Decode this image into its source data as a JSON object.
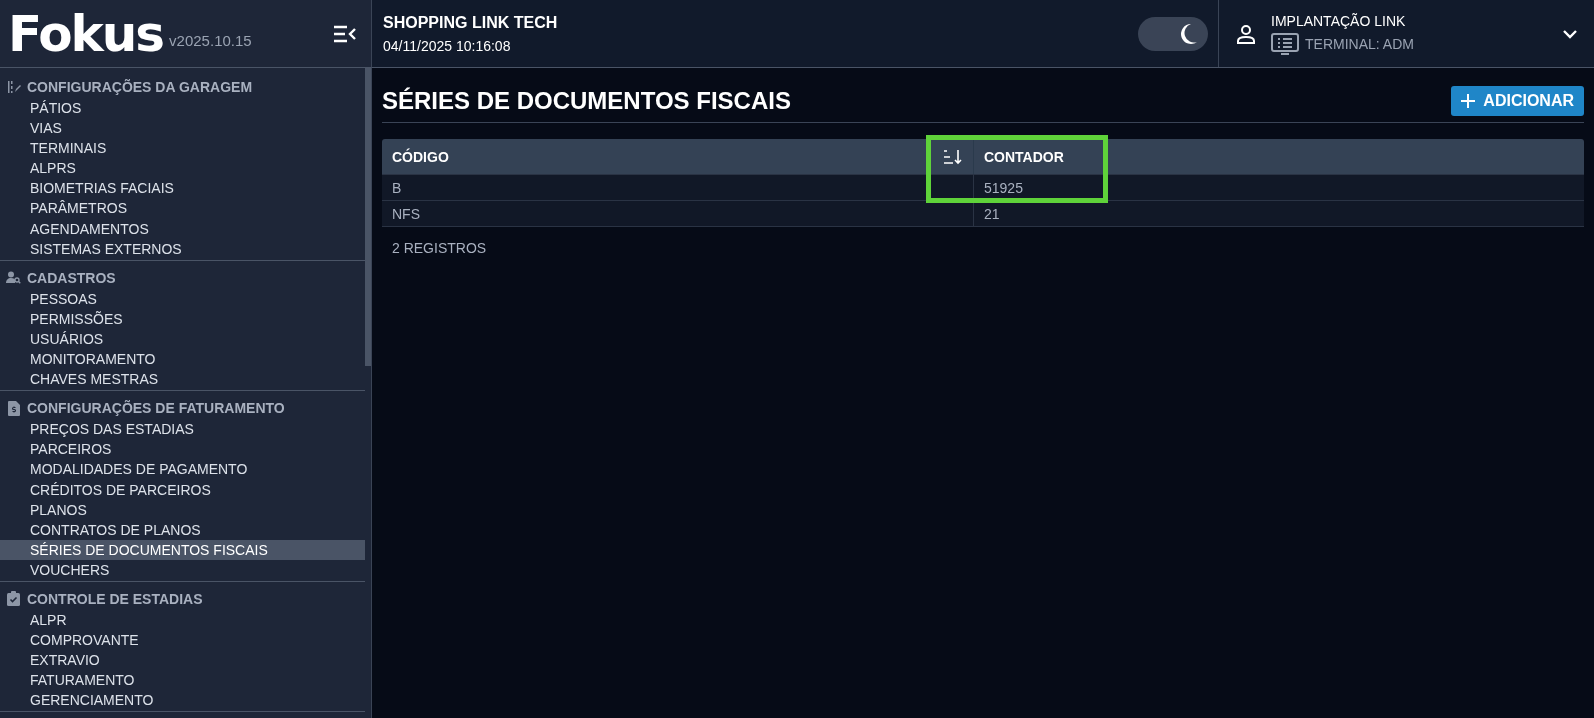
{
  "brand": {
    "logo": "Fokus",
    "version": "v2025.10.15"
  },
  "sidebar": {
    "sections": [
      {
        "title": "CONFIGURAÇÕES DA GARAGEM",
        "kind": "garage",
        "items": [
          {
            "label": "PÁTIOS",
            "selected": false
          },
          {
            "label": "VIAS",
            "selected": false
          },
          {
            "label": "TERMINAIS",
            "selected": false
          },
          {
            "label": "ALPRS",
            "selected": false
          },
          {
            "label": "BIOMETRIAS FACIAIS",
            "selected": false
          },
          {
            "label": "PARÂMETROS",
            "selected": false
          },
          {
            "label": "AGENDAMENTOS",
            "selected": false
          },
          {
            "label": "SISTEMAS EXTERNOS",
            "selected": false
          }
        ]
      },
      {
        "title": "CADASTROS",
        "kind": "people",
        "items": [
          {
            "label": "PESSOAS",
            "selected": false
          },
          {
            "label": "PERMISSÕES",
            "selected": false
          },
          {
            "label": "USUÁRIOS",
            "selected": false
          },
          {
            "label": "MONITORAMENTO",
            "selected": false
          },
          {
            "label": "CHAVES MESTRAS",
            "selected": false
          }
        ]
      },
      {
        "title": "CONFIGURAÇÕES DE FATURAMENTO",
        "kind": "invoice",
        "items": [
          {
            "label": "PREÇOS DAS ESTADIAS",
            "selected": false
          },
          {
            "label": "PARCEIROS",
            "selected": false
          },
          {
            "label": "MODALIDADES DE PAGAMENTO",
            "selected": false
          },
          {
            "label": "CRÉDITOS DE PARCEIROS",
            "selected": false
          },
          {
            "label": "PLANOS",
            "selected": false
          },
          {
            "label": "CONTRATOS DE PLANOS",
            "selected": false
          },
          {
            "label": "SÉRIES DE DOCUMENTOS FISCAIS",
            "selected": true
          },
          {
            "label": "VOUCHERS",
            "selected": false
          }
        ]
      },
      {
        "title": "CONTROLE DE ESTADIAS",
        "kind": "clipboard",
        "items": [
          {
            "label": "ALPR",
            "selected": false
          },
          {
            "label": "COMPROVANTE",
            "selected": false
          },
          {
            "label": "EXTRAVIO",
            "selected": false
          },
          {
            "label": "FATURAMENTO",
            "selected": false
          },
          {
            "label": "GERENCIAMENTO",
            "selected": false
          }
        ]
      }
    ]
  },
  "header": {
    "site": "SHOPPING LINK TECH",
    "datetime": "04/11/2025 10:16:08",
    "dark_mode": {
      "on": true
    },
    "user": "IMPLANTAÇÃO LINK",
    "terminal": "TERMINAL: ADM"
  },
  "page": {
    "title": "SÉRIES DE DOCUMENTOS FISCAIS",
    "add_button": "ADICIONAR",
    "table": {
      "columns": [
        {
          "label": "CÓDIGO",
          "sorted": true,
          "highlighted": false
        },
        {
          "label": "CONTADOR",
          "sorted": false,
          "highlighted": true
        }
      ],
      "rows": [
        [
          "B",
          "51925"
        ],
        [
          "NFS",
          "21"
        ]
      ]
    },
    "footer": "2 REGISTROS"
  }
}
